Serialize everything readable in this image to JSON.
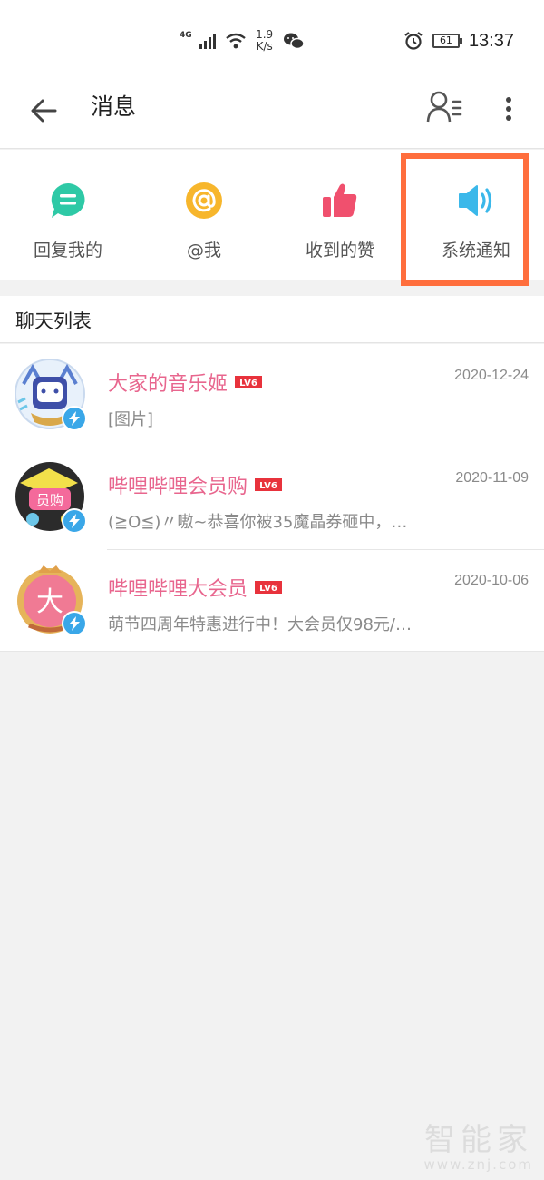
{
  "status_bar": {
    "network": "4G",
    "speed": "1.9\nK/s",
    "battery": "61",
    "time": "13:37",
    "icons": [
      "signal-icon",
      "wifi-icon",
      "wechat-icon",
      "alarm-icon",
      "battery-icon"
    ]
  },
  "header": {
    "title": "消息",
    "icons": [
      "back-arrow-icon",
      "contacts-icon",
      "more-vert-icon"
    ]
  },
  "quick_actions": [
    {
      "label": "回复我的",
      "icon": "reply-bubble-icon",
      "color": "#2ec9a6"
    },
    {
      "label": "@我",
      "icon": "at-icon",
      "color": "#f7b62c"
    },
    {
      "label": "收到的赞",
      "icon": "thumbs-up-icon",
      "color": "#f0506e"
    },
    {
      "label": "系统通知",
      "icon": "speaker-icon",
      "color": "#3bb8ea"
    }
  ],
  "highlight_color": "#ff6e3d",
  "chat_section": {
    "title": "聊天列表"
  },
  "chats": [
    {
      "name": "大家的音乐姬",
      "level": "LV6",
      "date": "2020-12-24",
      "preview": "[图片]"
    },
    {
      "name": "哔哩哔哩会员购",
      "level": "LV6",
      "date": "2020-11-09",
      "preview": "(≧O≦)〃嗷~恭喜你被35魔晶券砸中，…"
    },
    {
      "name": "哔哩哔哩大会员",
      "level": "LV6",
      "date": "2020-10-06",
      "preview": "萌节四周年特惠进行中！大会员仅98元/…"
    }
  ],
  "avatar_texts": {
    "shop": "员购",
    "vip": "大"
  },
  "colors": {
    "name_pink": "#e8668e",
    "verify_blue": "#3aa7e8",
    "level_red": "#e8323c"
  },
  "watermark": {
    "brand": "智能家",
    "url": "www.znj.com"
  }
}
